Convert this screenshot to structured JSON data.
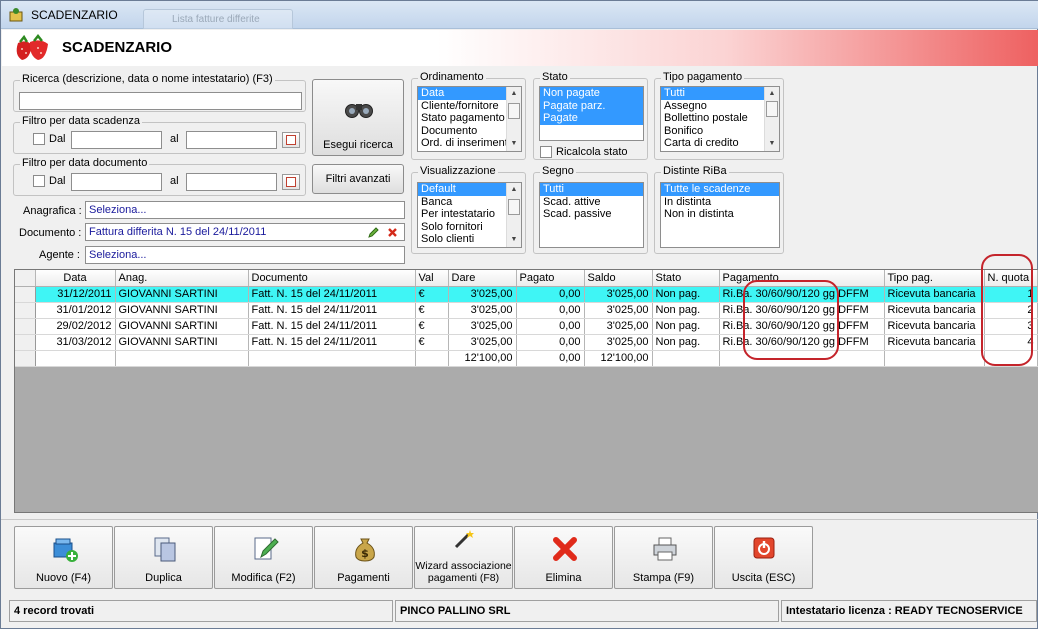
{
  "window": {
    "title": "SCADENZARIO",
    "ghost_tab": "Lista fatture differite"
  },
  "banner": {
    "title": "SCADENZARIO"
  },
  "search": {
    "legend": "Ricerca (descrizione, data o nome intestatario) (F3)",
    "value": ""
  },
  "filter_due": {
    "legend": "Filtro per data scadenza",
    "from_label": "Dal",
    "to_label": "al"
  },
  "filter_doc": {
    "legend": "Filtro per data documento",
    "from_label": "Dal",
    "to_label": "al"
  },
  "buttons": {
    "search": "Esegui ricerca",
    "advanced": "Filtri avanzati"
  },
  "fields": {
    "anagrafica_label": "Anagrafica :",
    "anagrafica_value": "Seleziona...",
    "documento_label": "Documento :",
    "documento_value": "Fattura differita N. 15 del 24/11/2011",
    "agente_label": "Agente :",
    "agente_value": "Seleziona..."
  },
  "ordinamento": {
    "legend": "Ordinamento",
    "items": [
      "Data",
      "Cliente/fornitore",
      "Stato pagamento",
      "Documento",
      "Ord. di inserimento"
    ],
    "selected": 0
  },
  "stato": {
    "legend": "Stato",
    "items": [
      "Non pagate",
      "Pagate parz.",
      "Pagate"
    ],
    "recalc_label": "Ricalcola stato"
  },
  "tipo_pagamento": {
    "legend": "Tipo pagamento",
    "items": [
      "Tutti",
      "Assegno",
      "Bollettino postale",
      "Bonifico",
      "Carta di credito"
    ]
  },
  "visualizzazione": {
    "legend": "Visualizzazione",
    "items": [
      "Default",
      "Banca",
      "Per intestatario",
      "Solo fornitori",
      "Solo clienti"
    ]
  },
  "segno": {
    "legend": "Segno",
    "items": [
      "Tutti",
      "Scad. attive",
      "Scad. passive"
    ]
  },
  "distinte": {
    "legend": "Distinte RiBa",
    "items": [
      "Tutte le scadenze",
      "In distinta",
      "Non in distinta"
    ]
  },
  "grid": {
    "columns": [
      "Data",
      "Anag.",
      "Documento",
      "Val",
      "Dare",
      "Pagato",
      "Saldo",
      "Stato",
      "Pagamento",
      "Tipo pag.",
      "N. quota"
    ],
    "rows": [
      [
        "31/12/2011",
        "GIOVANNI SARTINI",
        "Fatt. N. 15 del 24/11/2011",
        "€",
        "3'025,00",
        "0,00",
        "3'025,00",
        "Non pag.",
        "Ri.Ba. 30/60/90/120 gg DFFM",
        "Ricevuta bancaria",
        "1"
      ],
      [
        "31/01/2012",
        "GIOVANNI SARTINI",
        "Fatt. N. 15 del 24/11/2011",
        "€",
        "3'025,00",
        "0,00",
        "3'025,00",
        "Non pag.",
        "Ri.Ba. 30/60/90/120 gg DFFM",
        "Ricevuta bancaria",
        "2"
      ],
      [
        "29/02/2012",
        "GIOVANNI SARTINI",
        "Fatt. N. 15 del 24/11/2011",
        "€",
        "3'025,00",
        "0,00",
        "3'025,00",
        "Non pag.",
        "Ri.Ba. 30/60/90/120 gg DFFM",
        "Ricevuta bancaria",
        "3"
      ],
      [
        "31/03/2012",
        "GIOVANNI SARTINI",
        "Fatt. N. 15 del 24/11/2011",
        "€",
        "3'025,00",
        "0,00",
        "3'025,00",
        "Non pag.",
        "Ri.Ba. 30/60/90/120 gg DFFM",
        "Ricevuta bancaria",
        "4"
      ]
    ],
    "totals": {
      "dare": "12'100,00",
      "pagato": "0,00",
      "saldo": "12'100,00"
    }
  },
  "toolbar": [
    {
      "label": "Nuovo (F4)",
      "icon": "new-record-icon"
    },
    {
      "label": "Duplica",
      "icon": "duplicate-icon"
    },
    {
      "label": "Modifica (F2)",
      "icon": "edit-icon"
    },
    {
      "label": "Pagamenti",
      "icon": "money-bag-icon"
    },
    {
      "label": "Wizard associazione pagamenti (F8)",
      "icon": "wizard-icon"
    },
    {
      "label": "Elimina",
      "icon": "delete-icon"
    },
    {
      "label": "Stampa (F9)",
      "icon": "printer-icon"
    },
    {
      "label": "Uscita (ESC)",
      "icon": "exit-icon"
    }
  ],
  "status": {
    "records": "4 record trovati",
    "company": "PINCO PALLINO SRL",
    "license": "Intestatario licenza : READY TECNOSERVICE"
  },
  "colors": {
    "selection": "#3399ff",
    "current_row": "#3ff5f5",
    "highlight_ring": "#c4242b"
  }
}
